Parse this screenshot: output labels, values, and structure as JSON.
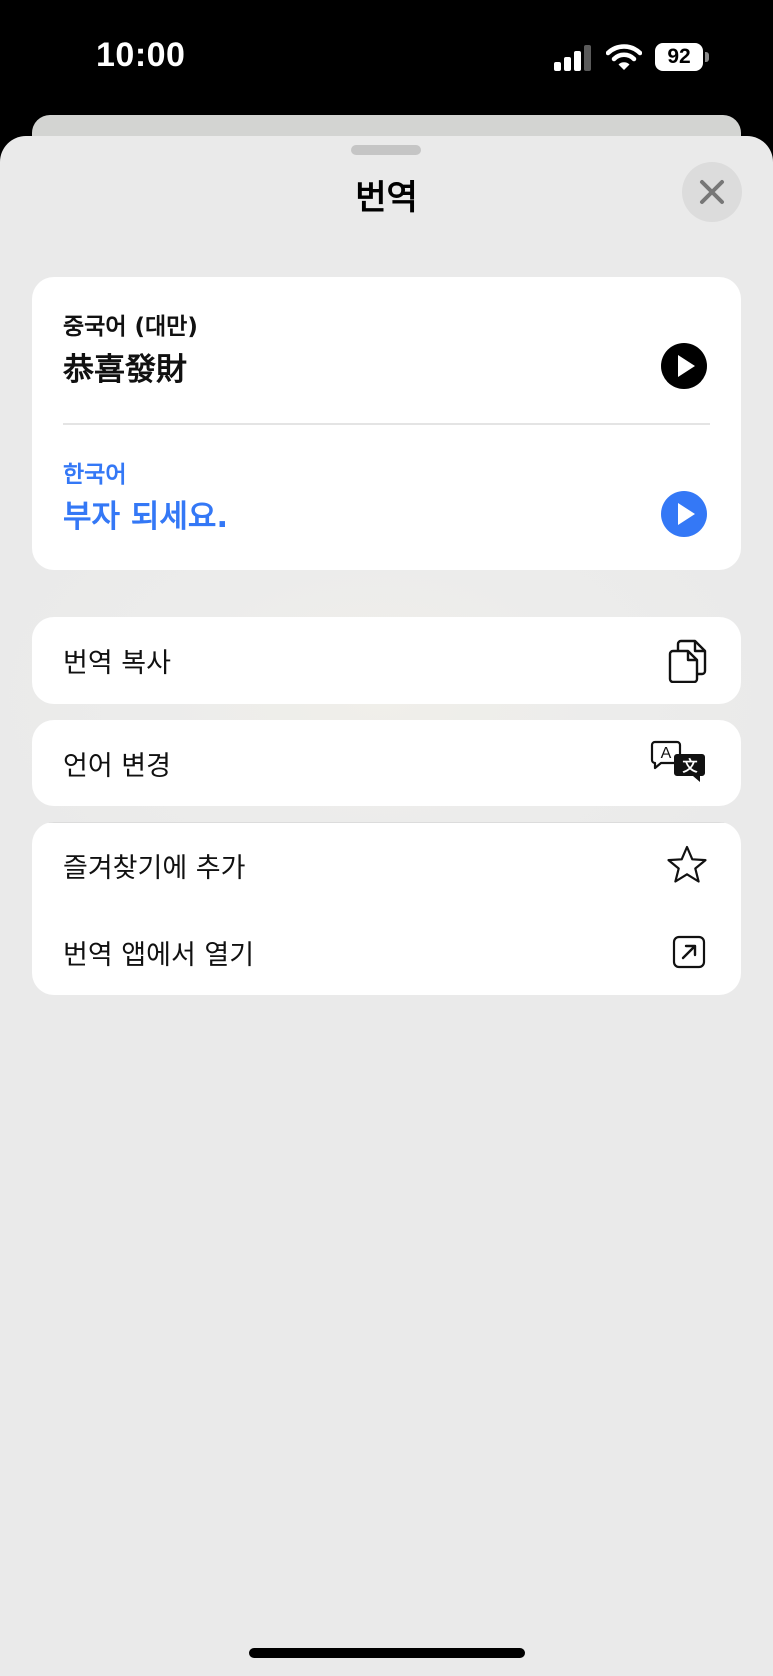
{
  "status_bar": {
    "time": "10:00",
    "battery": "92",
    "icons": [
      "signal-icon",
      "wifi-icon",
      "battery-icon"
    ]
  },
  "sheet": {
    "title": "번역",
    "close_icon": "close-icon"
  },
  "translation": {
    "source_language": "중국어 (대만)",
    "source_text": "恭喜發財",
    "target_language": "한국어",
    "target_text": "부자 되세요.",
    "accent_color": "#3478f6"
  },
  "actions": {
    "copy": {
      "label": "번역 복사",
      "icon": "copy-icon"
    },
    "change_language": {
      "label": "언어 변경",
      "icon": "translate-icon"
    },
    "add_favorite": {
      "label": "즐겨찾기에 추가",
      "icon": "star-icon"
    },
    "open_in_app": {
      "label": "번역 앱에서 열기",
      "icon": "open-external-icon"
    }
  }
}
